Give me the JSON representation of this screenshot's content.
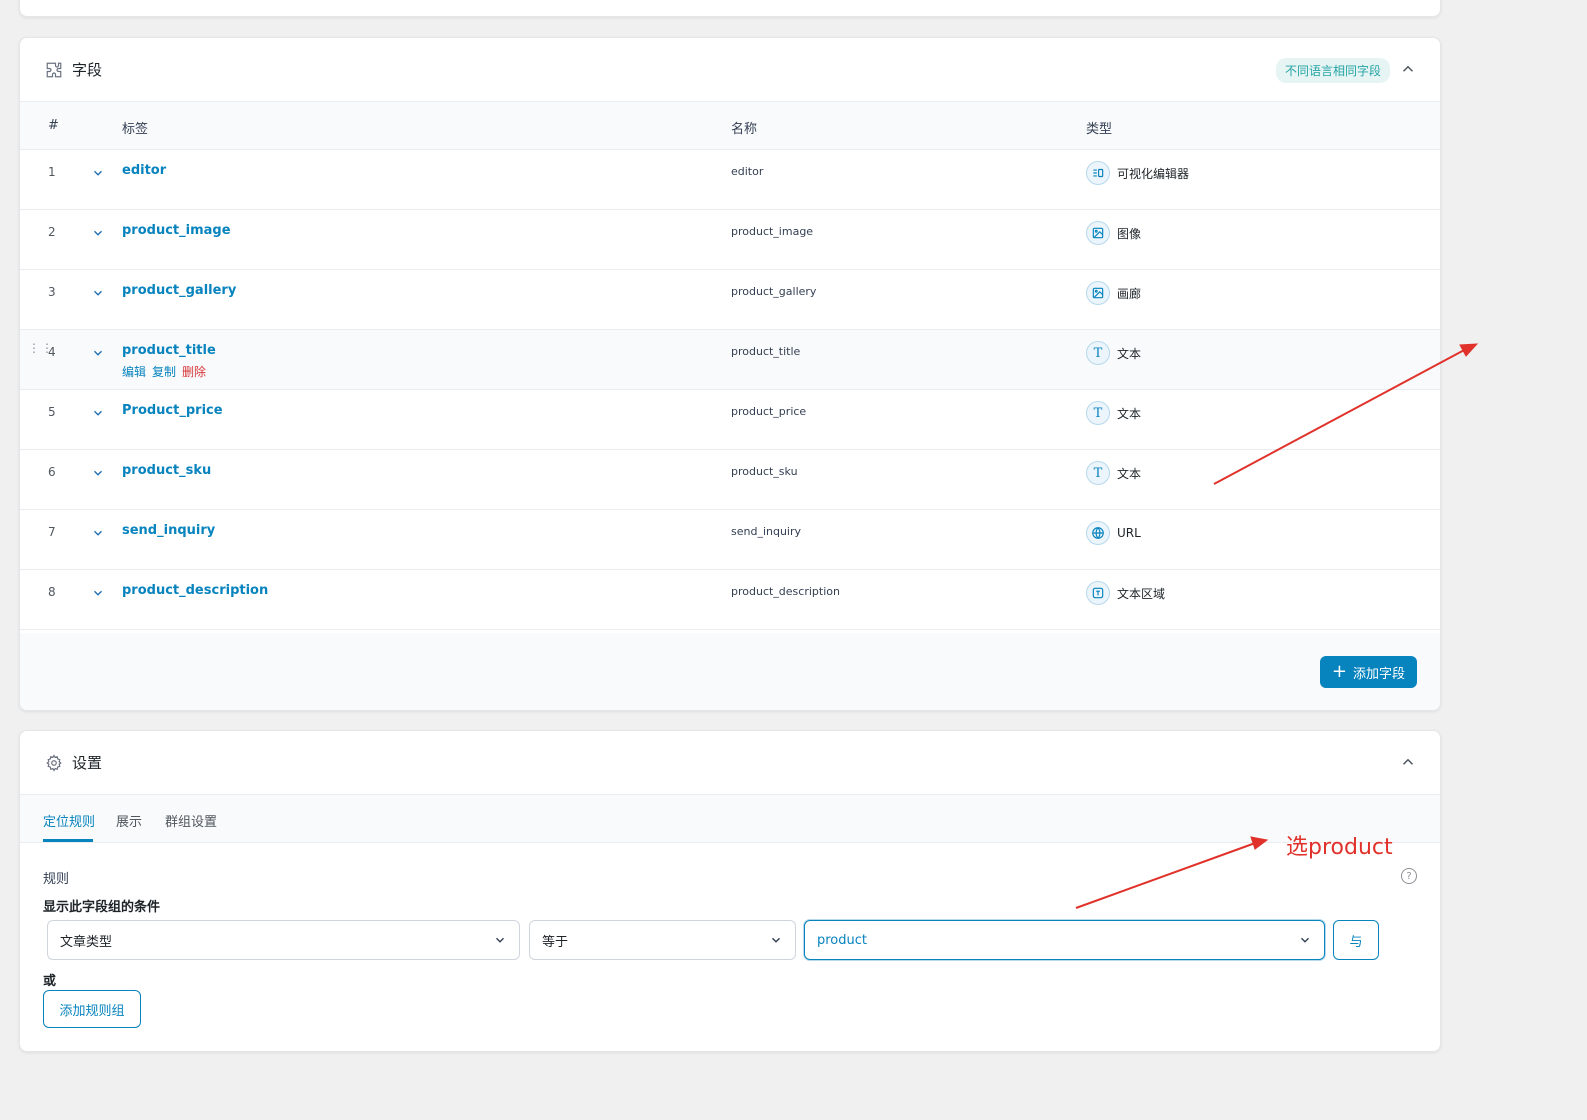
{
  "fields_panel": {
    "title": "字段",
    "badge": "不同语言相同字段",
    "columns": {
      "number": "#",
      "label": "标签",
      "name": "名称",
      "type": "类型"
    },
    "rows": [
      {
        "num": "1",
        "label": "editor",
        "name": "editor",
        "type": "可视化编辑器",
        "icon": "editor-icon"
      },
      {
        "num": "2",
        "label": "product_image",
        "name": "product_image",
        "type": "图像",
        "icon": "image-icon"
      },
      {
        "num": "3",
        "label": "product_gallery",
        "name": "product_gallery",
        "type": "画廊",
        "icon": "gallery-icon"
      },
      {
        "num": "4",
        "label": "product_title",
        "name": "product_title",
        "type": "文本",
        "icon": "text-icon"
      },
      {
        "num": "5",
        "label": "Product_price",
        "name": "product_price",
        "type": "文本",
        "icon": "text-icon"
      },
      {
        "num": "6",
        "label": "product_sku",
        "name": "product_sku",
        "type": "文本",
        "icon": "text-icon"
      },
      {
        "num": "7",
        "label": "send_inquiry",
        "name": "send_inquiry",
        "type": "URL",
        "icon": "globe-icon"
      },
      {
        "num": "8",
        "label": "product_description",
        "name": "product_description",
        "type": "文本区域",
        "icon": "textarea-icon"
      }
    ],
    "row_actions": {
      "edit": "编辑",
      "duplicate": "复制",
      "delete": "删除"
    },
    "add_field_label": "添加字段"
  },
  "settings_panel": {
    "title": "设置",
    "tabs": [
      "定位规则",
      "展示",
      "群组设置"
    ],
    "rules_label": "规则",
    "rules_description": "显示此字段组的条件",
    "rule": {
      "param": "文章类型",
      "operator": "等于",
      "value": "product"
    },
    "and_label": "与",
    "or_label": "或",
    "add_group_label": "添加规则组",
    "help_glyph": "?"
  },
  "annotation": {
    "text": "选product",
    "color": "#e0322b"
  },
  "colors": {
    "accent": "#0783be",
    "danger": "#d63638",
    "badge_text": "#25a4a4"
  }
}
